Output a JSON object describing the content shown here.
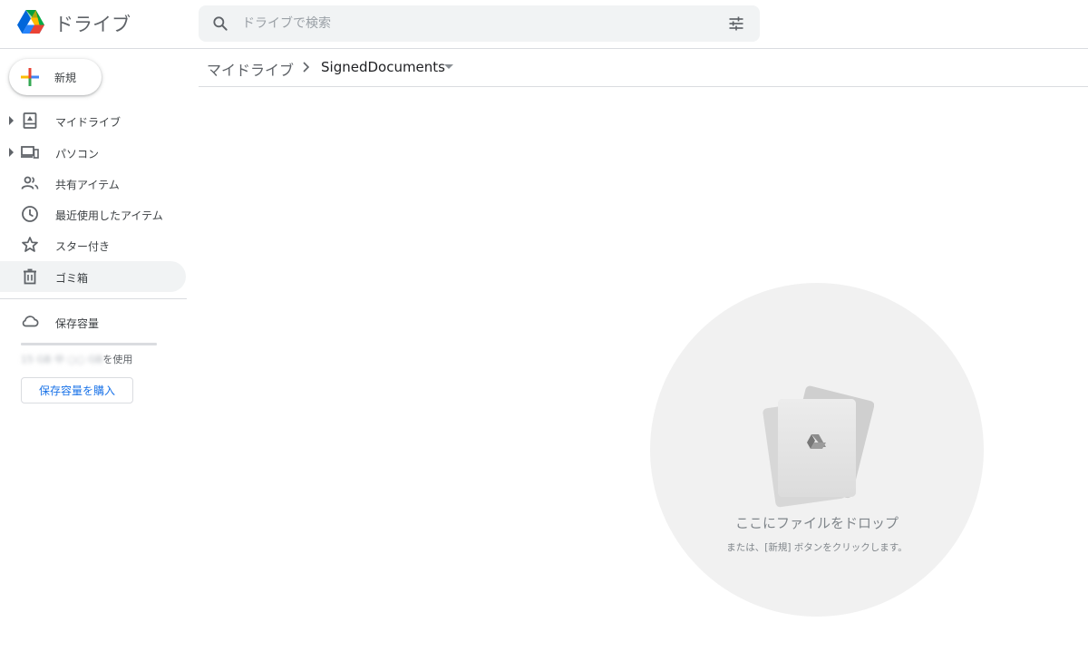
{
  "app": {
    "title": "ドライブ",
    "logo_icon": "google-drive-logo"
  },
  "search": {
    "placeholder": "ドライブで検索",
    "value": "",
    "search_icon": "search-icon",
    "options_icon": "tune-icon"
  },
  "sidebar": {
    "new_button_label": "新規",
    "items": [
      {
        "label": "マイドライブ",
        "icon": "my-drive-icon",
        "expandable": true,
        "active": false
      },
      {
        "label": "パソコン",
        "icon": "computers-icon",
        "expandable": true,
        "active": false
      },
      {
        "label": "共有アイテム",
        "icon": "shared-people-icon",
        "expandable": false,
        "active": false
      },
      {
        "label": "最近使用したアイテム",
        "icon": "clock-icon",
        "expandable": false,
        "active": false
      },
      {
        "label": "スター付き",
        "icon": "star-icon",
        "expandable": false,
        "active": false
      },
      {
        "label": "ゴミ箱",
        "icon": "trash-icon",
        "expandable": false,
        "active": true
      }
    ],
    "storage": {
      "label": "保存容量",
      "icon": "cloud-icon",
      "usage_amount": "15 GB 中 ○○ GB",
      "usage_suffix": "を使用",
      "buy_label": "保存容量を購入",
      "bar_fill_fraction": 1.0
    }
  },
  "breadcrumb": {
    "root": "マイドライブ",
    "current": "SignedDocuments"
  },
  "drop_zone": {
    "title": "ここにファイルをドロップ",
    "subtitle": "または、[新規] ボタンをクリックします。"
  },
  "colors": {
    "accent_blue": "#1a73e8",
    "active_background": "#f1f3f4",
    "divider": "#dadce0",
    "drop_zone_background": "#f1f1f1"
  }
}
